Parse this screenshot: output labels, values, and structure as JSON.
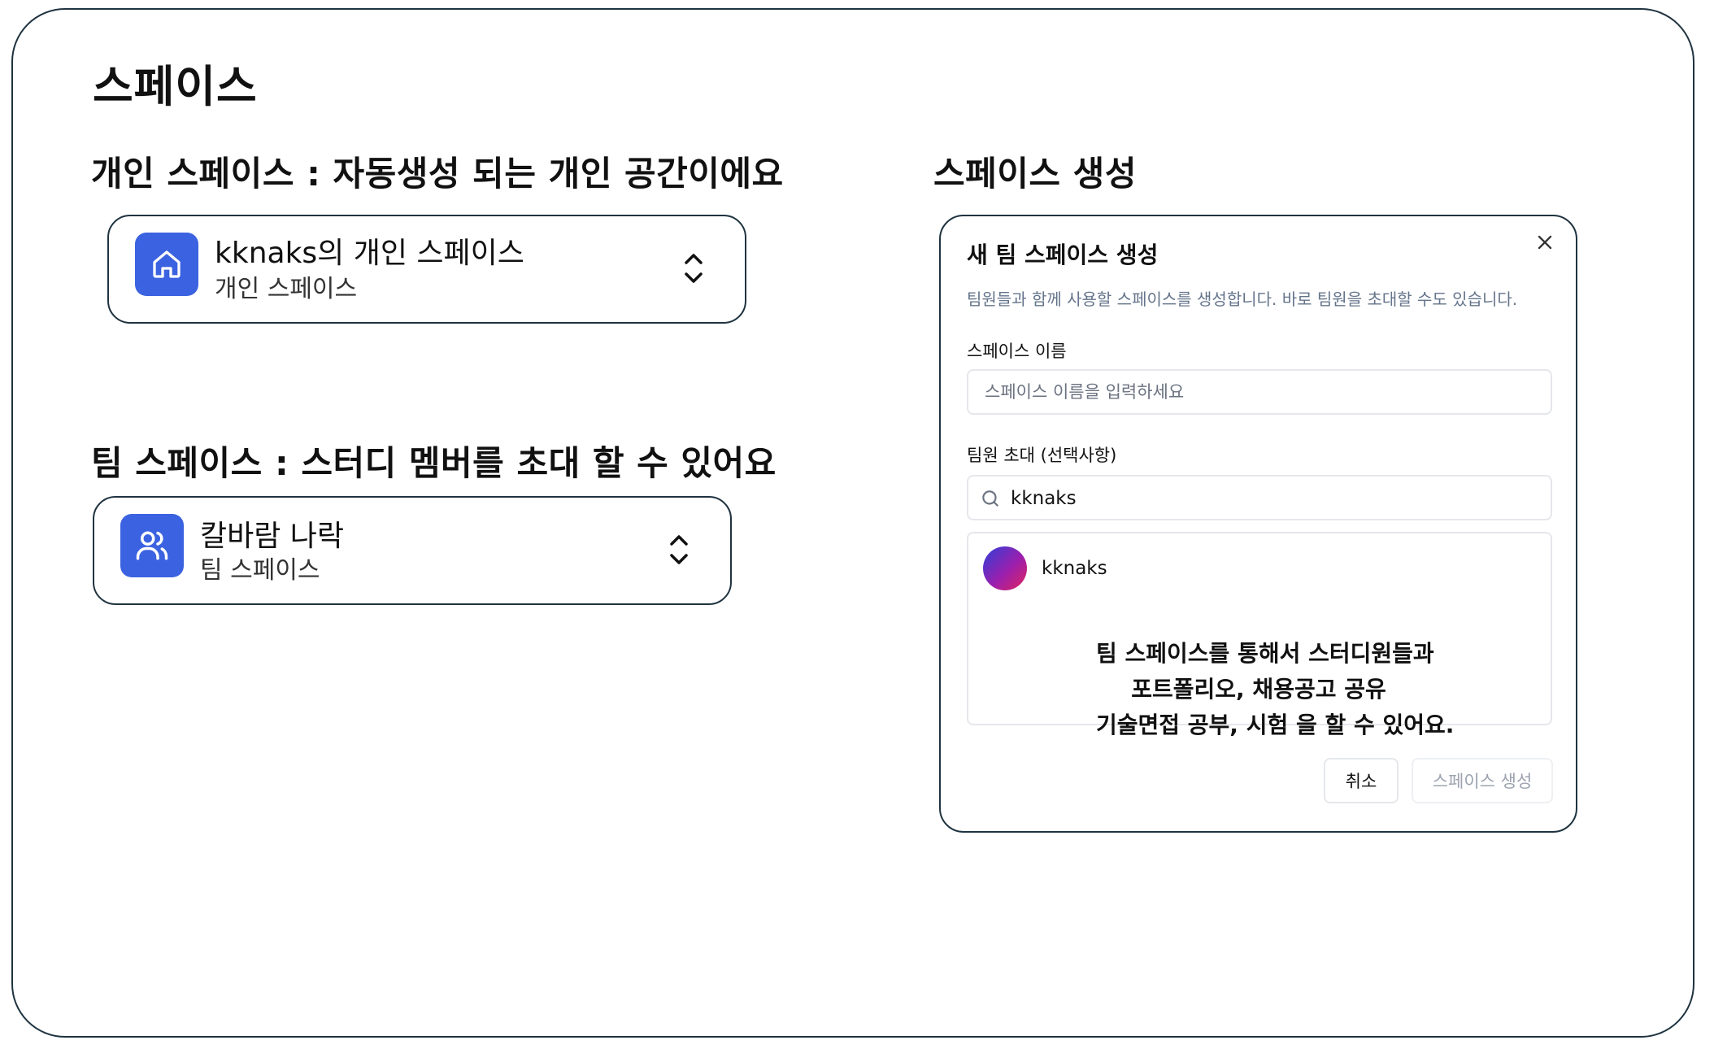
{
  "page_title": "스페이스",
  "personal_section": {
    "heading": "개인 스페이스 : 자동생성 되는 개인 공간이에요",
    "card": {
      "name": "kknaks의 개인 스페이스",
      "type": "개인 스페이스",
      "icon": "home-icon"
    }
  },
  "team_section": {
    "heading": "팀 스페이스 : 스터디 멤버를 초대 할 수 있어요",
    "card": {
      "name": "칼바람 나락",
      "type": "팀 스페이스",
      "icon": "users-icon"
    }
  },
  "create_section": {
    "heading": "스페이스 생성",
    "dialog": {
      "title": "새 팀 스페이스 생성",
      "description": "팀원들과 함께 사용할 스페이스를 생성합니다. 바로 팀원을 초대할 수도 있습니다.",
      "name_label": "스페이스 이름",
      "name_placeholder": "스페이스 이름을 입력하세요",
      "invite_label": "팀원 초대 (선택사항)",
      "search_value": "kknaks",
      "results": [
        {
          "name": "kknaks"
        }
      ],
      "cancel_label": "취소",
      "create_label": "스페이스 생성"
    }
  },
  "annotation": {
    "lines": [
      "팀 스페이스를 통해서 스터디원들과",
      "포트폴리오, 채용공고 공유",
      "기술면접 공부, 시험 을 할 수 있어요."
    ]
  },
  "colors": {
    "accent": "#3b62e0",
    "border": "#1f3340",
    "muted": "#64748b"
  }
}
